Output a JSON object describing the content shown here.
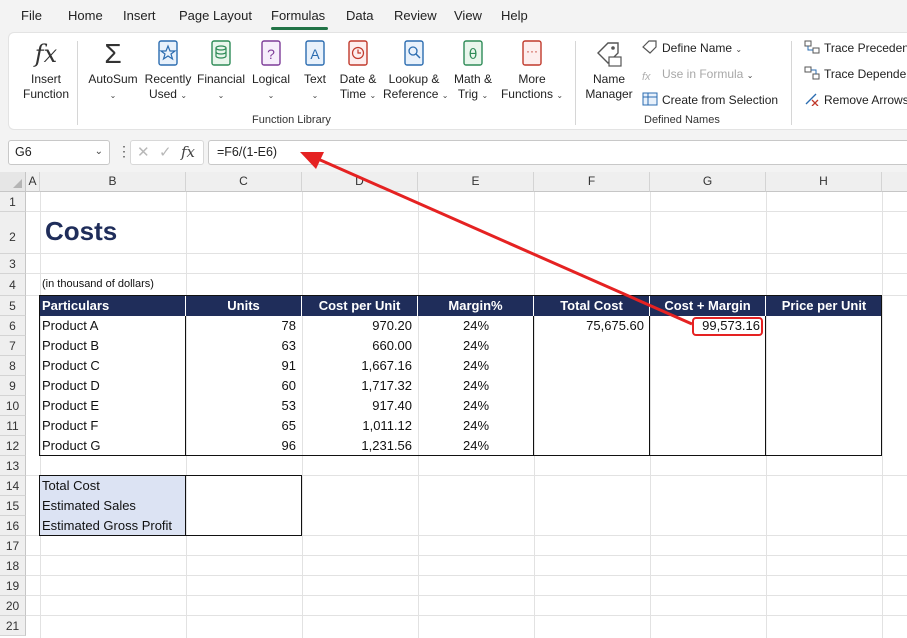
{
  "menu": {
    "items": [
      "File",
      "Home",
      "Insert",
      "Page Layout",
      "Formulas",
      "Data",
      "Review",
      "View",
      "Help"
    ],
    "active": "Formulas"
  },
  "ribbon": {
    "insert_function": [
      "Insert",
      "Function"
    ],
    "function_library": {
      "label": "Function Library",
      "buttons": [
        {
          "line1": "AutoSum",
          "line2": "",
          "icon": "sigma-icon"
        },
        {
          "line1": "Recently",
          "line2": "Used",
          "icon": "star-book-icon"
        },
        {
          "line1": "Financial",
          "line2": "",
          "icon": "coins-book-icon"
        },
        {
          "line1": "Logical",
          "line2": "",
          "icon": "question-book-icon"
        },
        {
          "line1": "Text",
          "line2": "",
          "icon": "text-book-icon"
        },
        {
          "line1": "Date &",
          "line2": "Time",
          "icon": "clock-book-icon"
        },
        {
          "line1": "Lookup &",
          "line2": "Reference",
          "icon": "magnifier-book-icon"
        },
        {
          "line1": "Math &",
          "line2": "Trig",
          "icon": "theta-book-icon"
        },
        {
          "line1": "More",
          "line2": "Functions",
          "icon": "more-book-icon"
        }
      ]
    },
    "defined_names": {
      "label": "Defined Names",
      "name_manager": [
        "Name",
        "Manager"
      ],
      "define_name": "Define Name",
      "use_in_formula": "Use in Formula",
      "create_from_selection": "Create from Selection"
    },
    "auditing": {
      "trace_precedents": "Trace Precedents",
      "trace_dependents": "Trace Dependents",
      "remove_arrows": "Remove Arrows"
    }
  },
  "formula_bar": {
    "name_box": "G6",
    "formula": "=F6/(1-E6)",
    "fx": "fx"
  },
  "columns": [
    "A",
    "B",
    "C",
    "D",
    "E",
    "F",
    "G",
    "H"
  ],
  "rows": [
    "1",
    "2",
    "3",
    "4",
    "5",
    "6",
    "7",
    "8",
    "9",
    "10",
    "11",
    "12",
    "13",
    "14",
    "15",
    "16",
    "17",
    "18",
    "19",
    "20",
    "21"
  ],
  "sheet": {
    "title": "Costs",
    "note": "(in thousand of dollars)",
    "headers": [
      "Particulars",
      "Units",
      "Cost per Unit",
      "Margin%",
      "Total Cost",
      "Cost + Margin",
      "Price per Unit"
    ],
    "products": [
      {
        "name": "Product A",
        "units": "78",
        "cost": "970.20",
        "margin": "24%",
        "total": "75,675.60",
        "cost_margin": "99,573.16"
      },
      {
        "name": "Product B",
        "units": "63",
        "cost": "660.00",
        "margin": "24%",
        "total": "",
        "cost_margin": ""
      },
      {
        "name": "Product C",
        "units": "91",
        "cost": "1,667.16",
        "margin": "24%",
        "total": "",
        "cost_margin": ""
      },
      {
        "name": "Product D",
        "units": "60",
        "cost": "1,717.32",
        "margin": "24%",
        "total": "",
        "cost_margin": ""
      },
      {
        "name": "Product E",
        "units": "53",
        "cost": "917.40",
        "margin": "24%",
        "total": "",
        "cost_margin": ""
      },
      {
        "name": "Product F",
        "units": "65",
        "cost": "1,011.12",
        "margin": "24%",
        "total": "",
        "cost_margin": ""
      },
      {
        "name": "Product G",
        "units": "96",
        "cost": "1,231.56",
        "margin": "24%",
        "total": "",
        "cost_margin": ""
      }
    ],
    "summary": [
      "Total Cost",
      "Estimated Sales",
      "Estimated Gross Profit"
    ]
  },
  "colors": {
    "header_fill": "#1f2d5a",
    "summary_fill": "#dce3f3",
    "annotation": "#e52222",
    "accent": "#217346"
  }
}
